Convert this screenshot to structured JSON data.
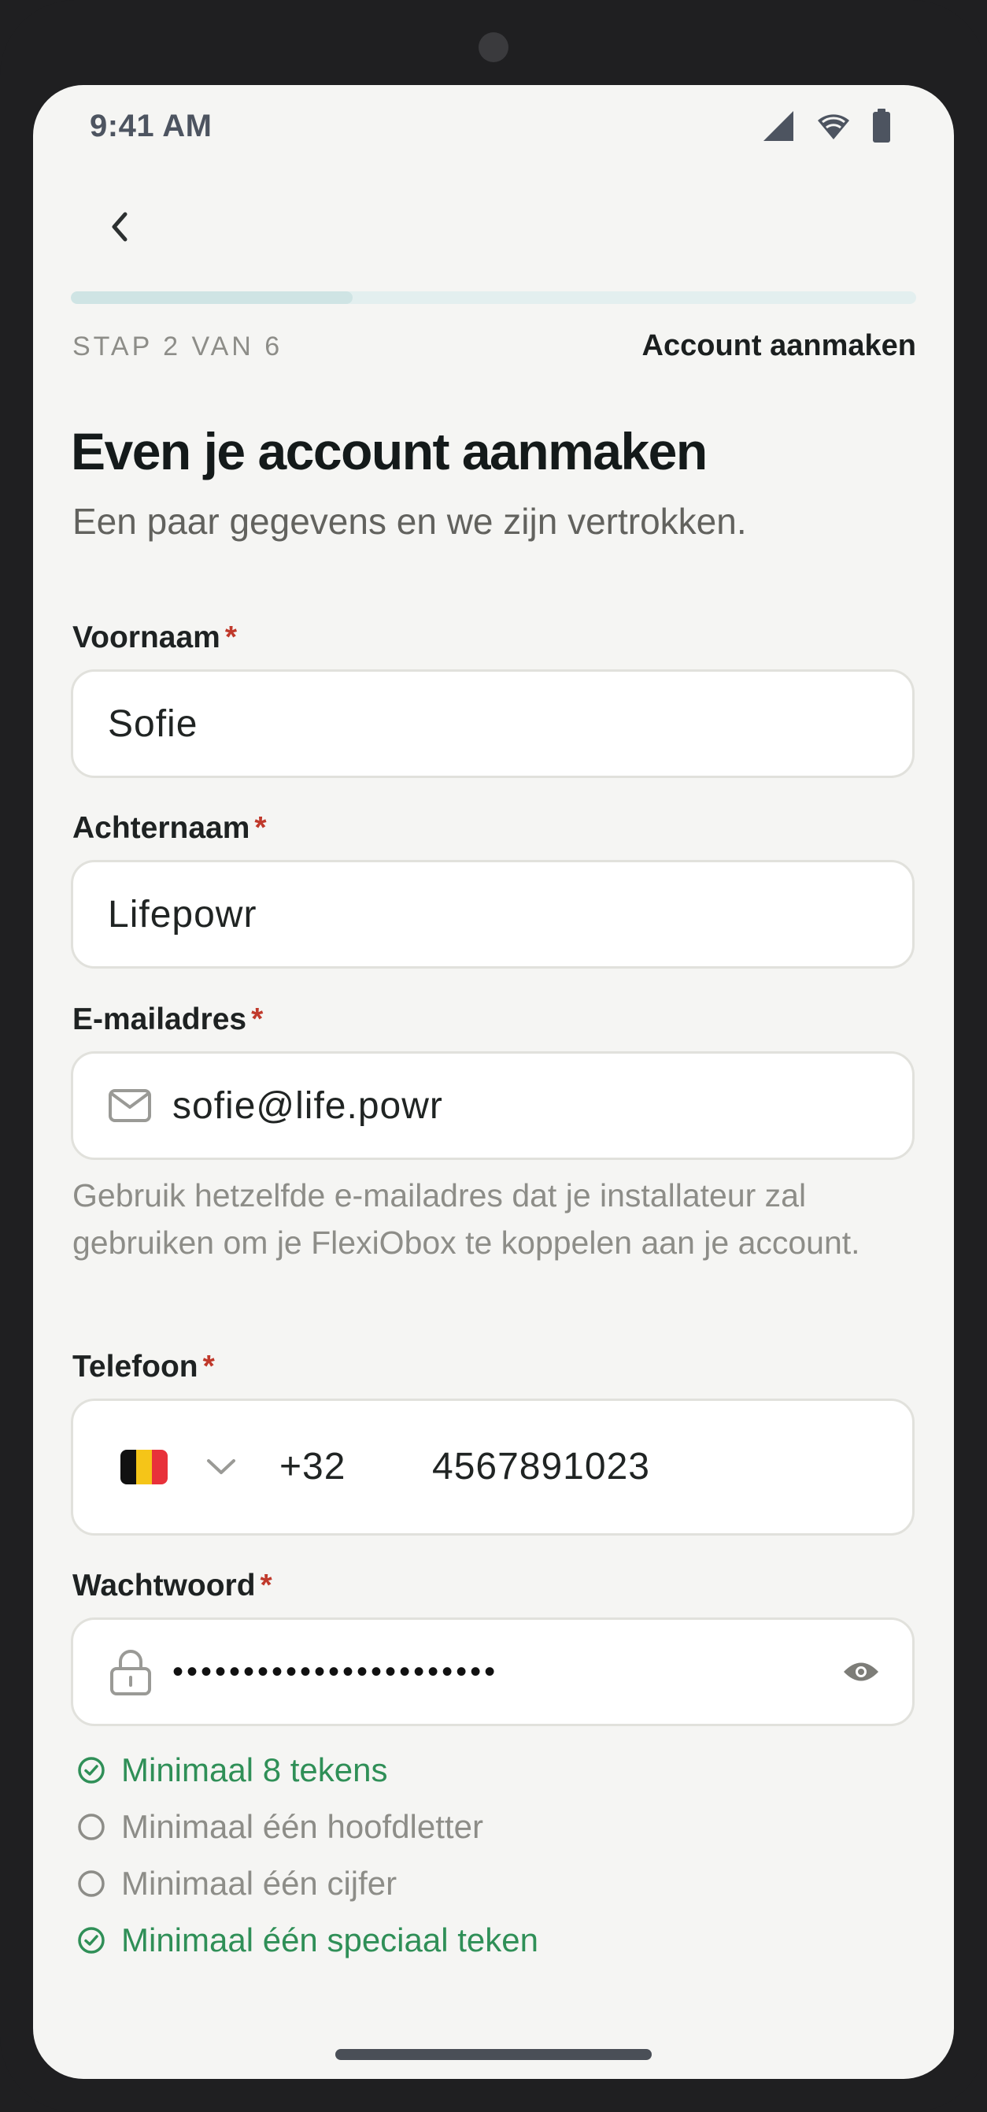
{
  "status_bar": {
    "time": "9:41 AM"
  },
  "header": {
    "back_icon": "chevron-left-icon"
  },
  "progress": {
    "step_text": "STAP 2 VAN 6",
    "step_title": "Account aanmaken",
    "fraction": 0.333
  },
  "page": {
    "title": "Even je account aanmaken",
    "subtitle": "Een paar gegevens en we zijn vertrokken."
  },
  "form": {
    "required_mark": "*",
    "first_name": {
      "label": "Voornaam",
      "value": "Sofie"
    },
    "last_name": {
      "label": "Achternaam",
      "value": "Lifepowr"
    },
    "email": {
      "label": "E-mailadres",
      "value": "sofie@life.powr",
      "icon": "mail-icon",
      "help": "Gebruik hetzelfde e-mailadres dat je installateur zal gebruiken om je FlexiObox te koppelen aan je account."
    },
    "phone": {
      "label": "Telefoon",
      "country_flag": "belgium-flag",
      "country_code": "+32",
      "number": "4567891023"
    },
    "password": {
      "label": "Wachtwoord",
      "masked_value": "•••••••••••••••••••••••",
      "icon": "lock-icon",
      "toggle_icon": "eye-icon"
    }
  },
  "password_rules": [
    {
      "text": "Minimaal 8 tekens",
      "met": true
    },
    {
      "text": "Minimaal één hoofdletter",
      "met": false
    },
    {
      "text": "Minimaal één cijfer",
      "met": false
    },
    {
      "text": "Minimaal één speciaal teken",
      "met": true
    }
  ],
  "colors": {
    "accent_green": "#2f8f57",
    "required_red": "#c0392b",
    "flag_black": "#111111",
    "flag_yellow": "#f5c518",
    "flag_red": "#e8313a"
  }
}
